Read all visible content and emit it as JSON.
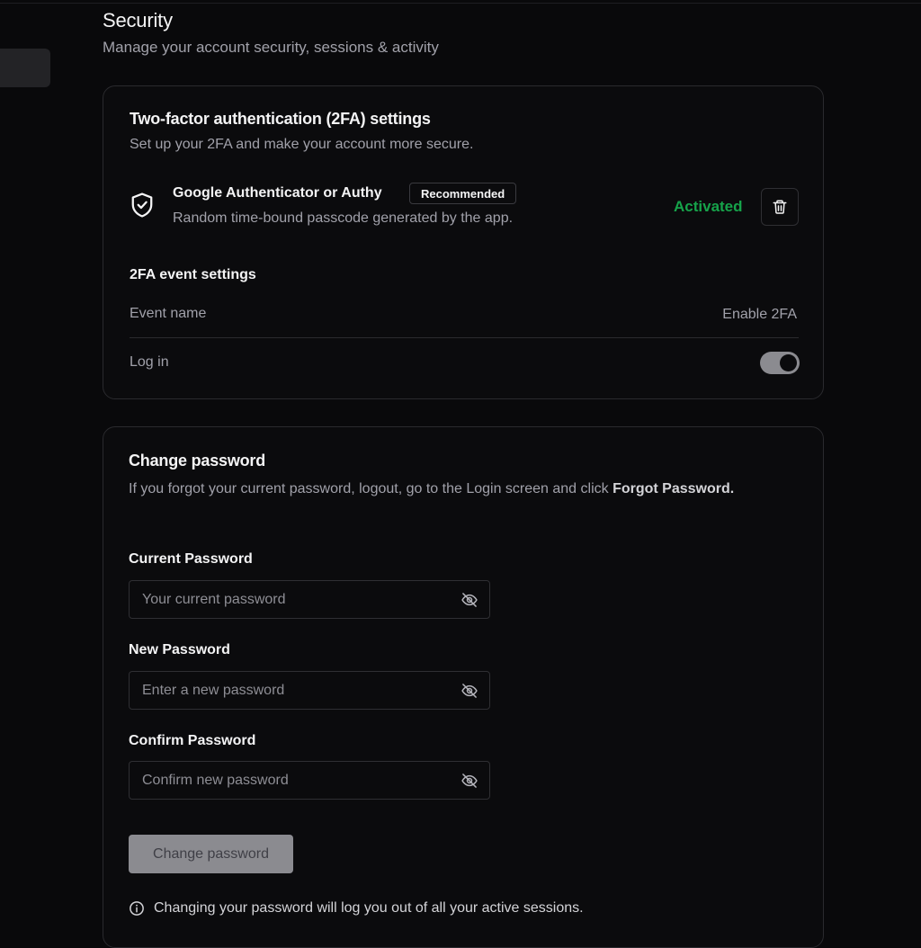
{
  "header": {
    "title": "Security",
    "subtitle": "Manage your account security, sessions & activity"
  },
  "twofa": {
    "title": "Two-factor authentication (2FA) settings",
    "subtitle": "Set up your 2FA and make your account more secure.",
    "method": {
      "icon": "shield-check-icon",
      "name": "Google Authenticator or Authy",
      "badge": "Recommended",
      "description": "Random time-bound passcode generated by the app.",
      "status": "Activated",
      "status_color": "#16a34a",
      "delete_icon": "trash-icon"
    },
    "events": {
      "title": "2FA event settings",
      "column_event": "Event name",
      "column_action": "Enable 2FA",
      "rows": [
        {
          "name": "Log in",
          "enabled": true
        }
      ]
    }
  },
  "password": {
    "title": "Change password",
    "description_prefix": "If you forgot your current password, logout, go to the Login screen and click ",
    "description_link": "Forgot Password.",
    "fields": {
      "current": {
        "label": "Current Password",
        "placeholder": "Your current password",
        "value": ""
      },
      "new": {
        "label": "New Password",
        "placeholder": "Enter a new password",
        "value": ""
      },
      "confirm": {
        "label": "Confirm Password",
        "placeholder": "Confirm new password",
        "value": ""
      }
    },
    "submit_label": "Change password",
    "info_text": "Changing your password will log you out of all your active sessions."
  }
}
